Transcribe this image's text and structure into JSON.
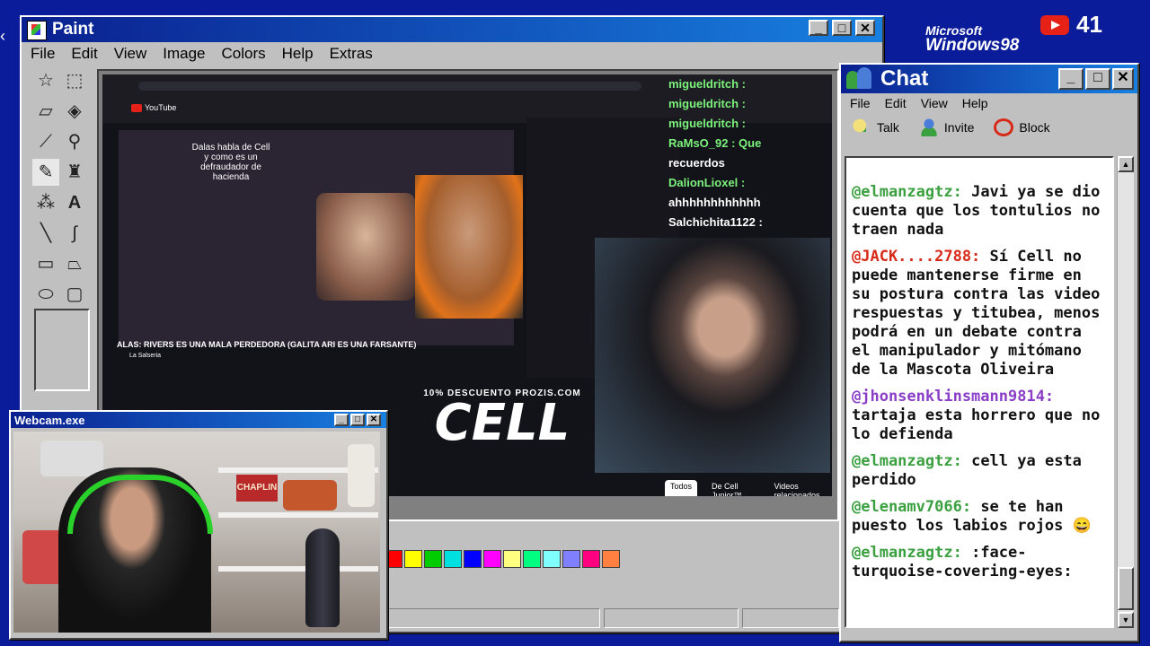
{
  "paint": {
    "title": "Paint",
    "menu": [
      "File",
      "Edit",
      "View",
      "Image",
      "Colors",
      "Help",
      "Extras"
    ],
    "tools": [
      "free-select",
      "rect-select",
      "eraser",
      "fill",
      "eyedropper",
      "magnifier",
      "pencil",
      "brush",
      "airbrush",
      "text",
      "line",
      "curve",
      "rectangle",
      "polygon",
      "ellipse",
      "rounded-rect"
    ],
    "palette": [
      "#ff0000",
      "#ffff00",
      "#00cc00",
      "#00e0e0",
      "#0000ff",
      "#ff00ff",
      "#ffff80",
      "#00ff80",
      "#80ffff",
      "#8080ff",
      "#ff0080",
      "#ff8040"
    ]
  },
  "stream": {
    "yt_title": "ALAS: RIVERS ES UNA MALA PERDEDORA (GALITA ARI ES UNA FARSANTE)",
    "channel": "La Salseria",
    "inner_caption": "Dalas habla de Cell y como es un defraudador de hacienda",
    "promo": "10% DESCUENTO PROZIS.COM",
    "logo": "CELL",
    "tabs": [
      "Todos",
      "De Cell Junior™",
      "Videos relacionados"
    ],
    "overlay_chat": [
      {
        "name": "migueldritch :",
        "text": ""
      },
      {
        "name": "migueldritch :",
        "text": ""
      },
      {
        "name": "migueldritch :",
        "text": ""
      },
      {
        "name": "RaMsO_92 : Que",
        "text": "recuerdos"
      },
      {
        "name": "DalionLioxel :",
        "text": ""
      },
      {
        "name": "",
        "text": "ahhhhhhhhhhhh"
      },
      {
        "name": "Salchichita1122 :",
        "text": ""
      }
    ]
  },
  "webcam": {
    "title": "Webcam.exe",
    "sign": "CHAPLIN"
  },
  "chat": {
    "title": "Chat",
    "menu": [
      "File",
      "Edit",
      "View",
      "Help"
    ],
    "toolbar": [
      "Talk",
      "Invite",
      "Block"
    ],
    "messages": [
      {
        "user": "@elmanzagtz:",
        "color": "green",
        "text": "Javi ya se dio cuenta que los tontulios no traen nada"
      },
      {
        "user": "@JACK....2788:",
        "color": "red",
        "text": "Sí Cell no puede mantenerse firme en su postura contra las video respuestas y titubea, menos podrá en un debate contra el manipulador y mitómano de la Mascota Oliveira"
      },
      {
        "user": "@jhonsenklinsmann9814:",
        "color": "purple",
        "text": "tartaja esta horrero que no lo defienda"
      },
      {
        "user": "@elmanzagtz:",
        "color": "green",
        "text": "cell ya esta perdido"
      },
      {
        "user": "@elenamv7066:",
        "color": "green",
        "text": "se te han puesto los labios rojos 😄"
      },
      {
        "user": "@elmanzagtz:",
        "color": "green",
        "text": ":face-turquoise-covering-eyes:"
      }
    ]
  },
  "overlay": {
    "win_brand_top": "Microsoft",
    "win_brand": "Windows98",
    "viewer_count": "41"
  }
}
